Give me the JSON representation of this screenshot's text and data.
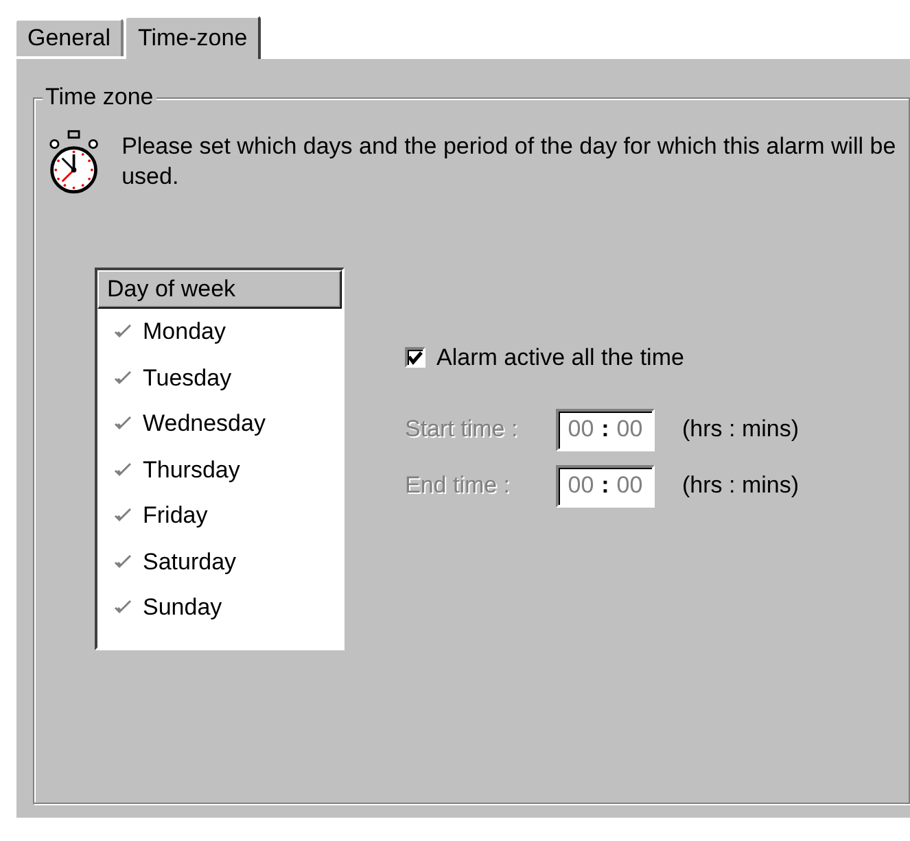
{
  "tabs": [
    {
      "label": "General",
      "selected": false
    },
    {
      "label": "Time-zone",
      "selected": true
    }
  ],
  "group": {
    "title": "Time zone",
    "description": "Please set which days and the period of the day for which this alarm will be used."
  },
  "day_list": {
    "header": "Day of week",
    "items": [
      {
        "label": "Monday",
        "checked": true
      },
      {
        "label": "Tuesday",
        "checked": true
      },
      {
        "label": "Wednesday",
        "checked": true
      },
      {
        "label": "Thursday",
        "checked": true
      },
      {
        "label": "Friday",
        "checked": true
      },
      {
        "label": "Saturday",
        "checked": true
      },
      {
        "label": "Sunday",
        "checked": true
      }
    ]
  },
  "alarm_checkbox": {
    "label": "Alarm active all the time",
    "checked": true
  },
  "time_fields": [
    {
      "label": "Start time :",
      "hours": "00",
      "separator": ":",
      "minutes": "00",
      "unit": "(hrs : mins)",
      "disabled": true
    },
    {
      "label": "End time :",
      "hours": "00",
      "separator": ":",
      "minutes": "00",
      "unit": "(hrs : mins)",
      "disabled": true
    }
  ]
}
